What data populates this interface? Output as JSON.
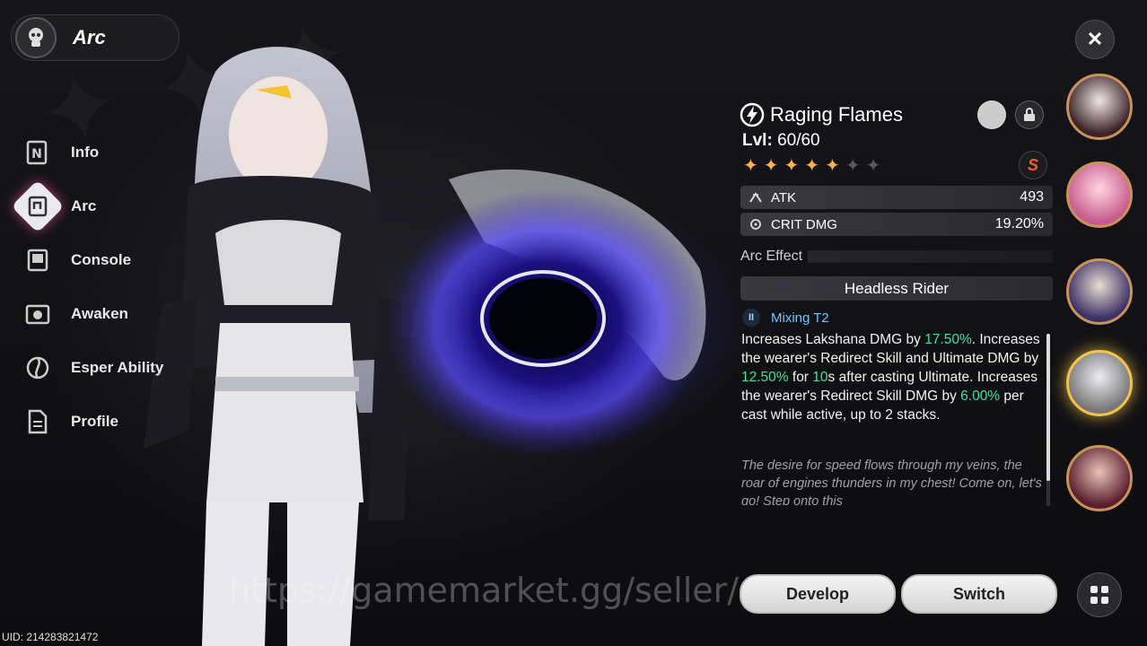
{
  "header": {
    "title": "Arc"
  },
  "nav": {
    "items": [
      {
        "label": "Info",
        "icon": "info-icon"
      },
      {
        "label": "Arc",
        "icon": "arc-icon",
        "active": true
      },
      {
        "label": "Console",
        "icon": "console-icon"
      },
      {
        "label": "Awaken",
        "icon": "awaken-icon"
      },
      {
        "label": "Esper Ability",
        "icon": "esper-ability-icon"
      },
      {
        "label": "Profile",
        "icon": "profile-icon"
      }
    ]
  },
  "arc": {
    "name": "Raging Flames",
    "level_label": "Lvl:",
    "level": "60/60",
    "stars_filled": 5,
    "stars_total": 7,
    "stats": [
      {
        "name": "ATK",
        "value": "493",
        "icon": "atk-icon"
      },
      {
        "name": "CRIT DMG",
        "value": "19.20%",
        "icon": "crit-icon"
      }
    ],
    "effect_section": "Arc Effect",
    "effect_name": "Headless Rider",
    "mixing": "Mixing T2",
    "mixing_icon": "II",
    "desc": {
      "p1": "Increases Lakshana DMG by ",
      "v1": "17.50%",
      "p2": ". Increases the wearer's Redirect Skill and Ultimate DMG by ",
      "v2": "12.50%",
      "p3": " for ",
      "v3": "10",
      "p4": "s after casting Ultimate. Increases the wearer's Redirect Skill DMG by ",
      "v4": "6.00%",
      "p5": " per cast while active, up to 2 stacks."
    },
    "flavor": "The desire for speed flows through my veins, the roar of engines thunders in my chest! Come on, let's go! Step onto this",
    "badge": "S"
  },
  "buttons": {
    "develop": "Develop",
    "switch": "Switch"
  },
  "watermark": "https://gamemarket.gg/seller/@...",
  "uid": "UID: 214283821472",
  "close_symbol": "✕",
  "colors": {
    "highlight": "#3ce3a0",
    "mixing": "#6ec6ff",
    "selected_avatar_ring": "#f3c44b"
  }
}
